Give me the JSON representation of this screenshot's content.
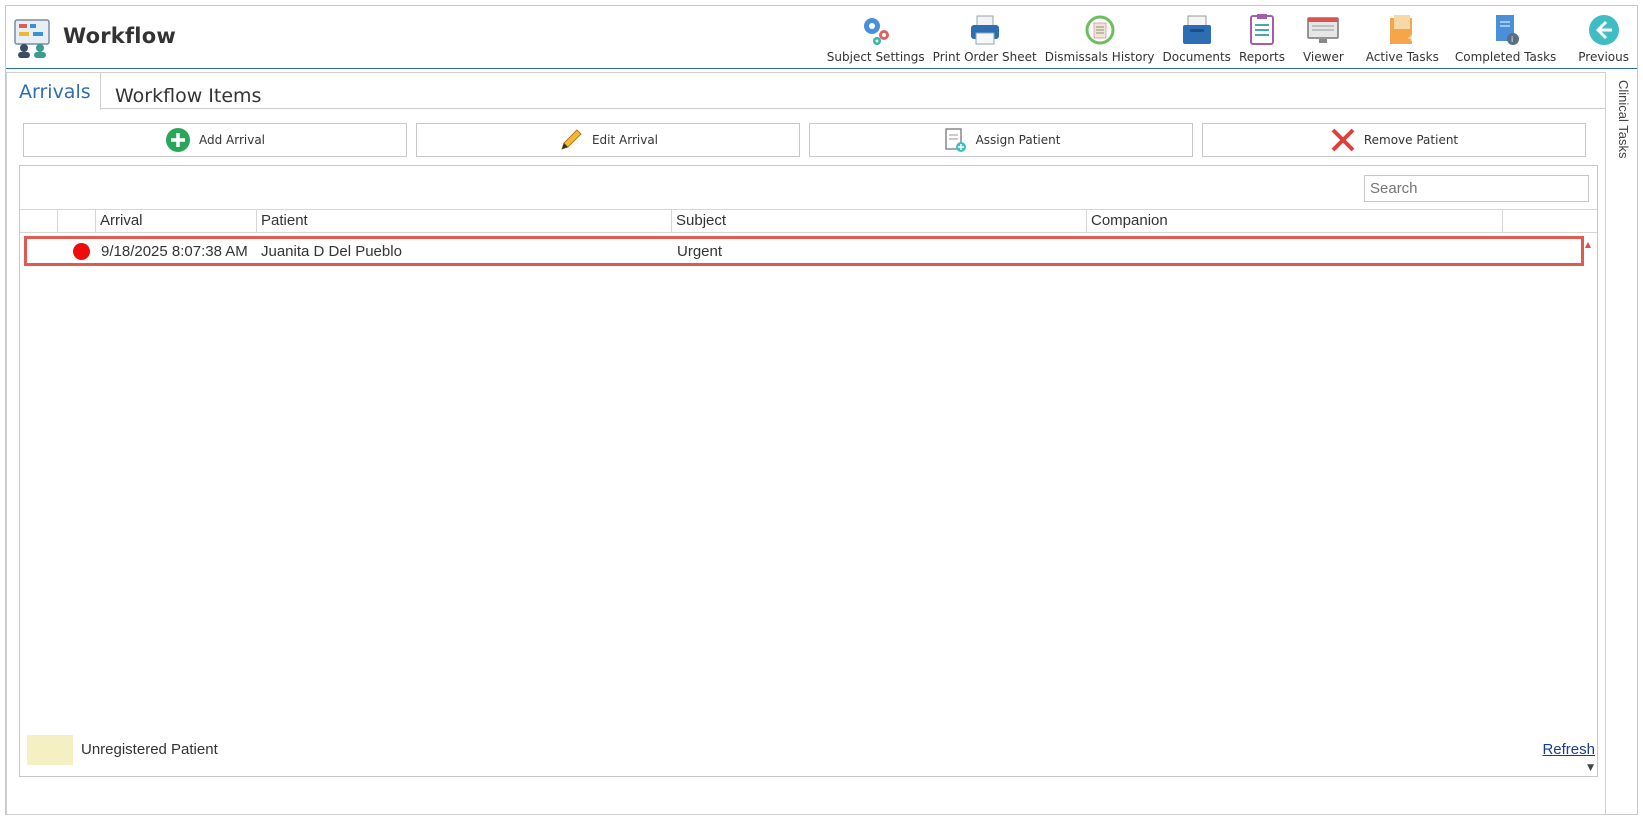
{
  "app": {
    "title": "Workflow"
  },
  "toolbar": [
    {
      "label": "Subject Settings",
      "icon": "gears-icon"
    },
    {
      "label": "Print Order Sheet",
      "icon": "printer-icon"
    },
    {
      "label": "Dismissals History",
      "icon": "history-icon"
    },
    {
      "label": "Documents",
      "icon": "documents-tray-icon"
    },
    {
      "label": "Reports",
      "icon": "report-clipboard-icon"
    },
    {
      "label": "Viewer",
      "icon": "monitor-icon"
    },
    {
      "label": "Active Tasks",
      "icon": "active-tasks-icon"
    },
    {
      "label": "Completed Tasks",
      "icon": "completed-tasks-icon"
    },
    {
      "label": "Previous",
      "icon": "back-arrow-icon"
    }
  ],
  "tabs": [
    {
      "label": "Arrivals",
      "active": true
    },
    {
      "label": "Workflow Items",
      "active": false
    }
  ],
  "actions": {
    "add": "Add Arrival",
    "edit": "Edit Arrival",
    "assign": "Assign Patient",
    "remove": "Remove Patient"
  },
  "search": {
    "placeholder": "Search"
  },
  "grid": {
    "columns": [
      "Arrival",
      "Patient",
      "Subject",
      "Companion"
    ],
    "rows": [
      {
        "status_color": "#f00c0c",
        "arrival": "9/18/2025 8:07:38 AM",
        "patient": "Juanita D Del Pueblo",
        "subject": "Urgent",
        "companion": ""
      }
    ]
  },
  "legend": {
    "label": "Unregistered Patient",
    "color": "#f5f0c3"
  },
  "refresh_label": "Refresh",
  "side_panel": {
    "label": "Clinical Tasks"
  },
  "colors": {
    "accent": "#2d6db3",
    "highlight": "#e05a4f"
  }
}
